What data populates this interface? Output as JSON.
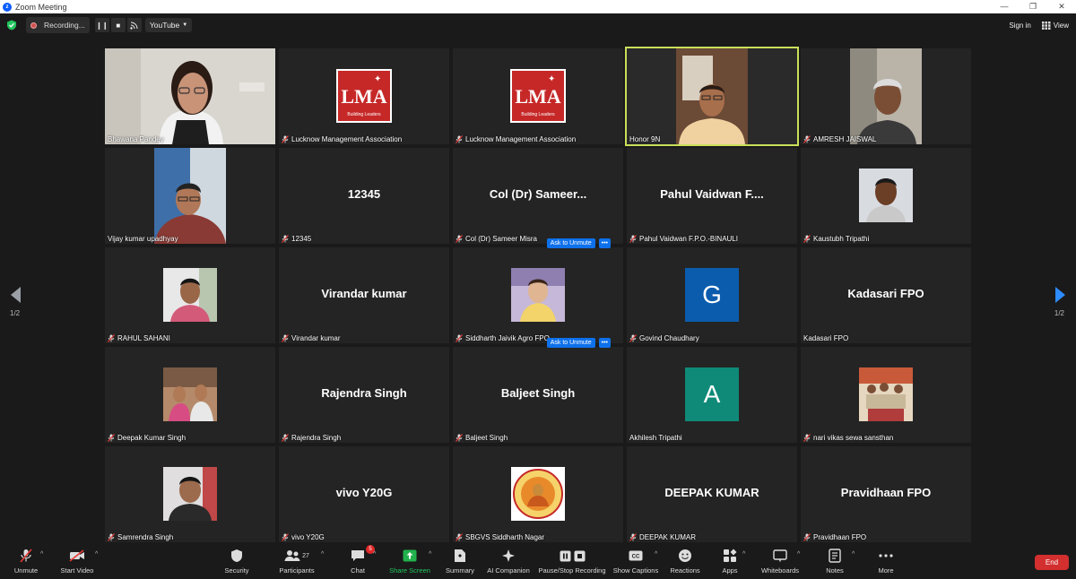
{
  "window": {
    "title": "Zoom Meeting"
  },
  "topbar": {
    "recording_label": "Recording...",
    "stream_label": "YouTube",
    "signin_label": "Sign in",
    "view_label": "View"
  },
  "pager": {
    "left": "1/2",
    "right": "1/2"
  },
  "tiles": [
    {
      "name": "Bhawana Pandey",
      "display": "",
      "kind": "video"
    },
    {
      "name": "Lucknow Management Association",
      "display": "",
      "kind": "logo"
    },
    {
      "name": "Lucknow Management Association",
      "display": "",
      "kind": "logo"
    },
    {
      "name": "Honor 9N",
      "display": "",
      "kind": "video"
    },
    {
      "name": "AMRESH JAISWAL",
      "display": "",
      "kind": "video"
    },
    {
      "name": "Vijay kumar upadhyay",
      "display": "",
      "kind": "video"
    },
    {
      "name": "12345",
      "display": "12345",
      "kind": "text"
    },
    {
      "name": "Col (Dr) Sameer Misra",
      "display": "Col  (Dr)  Sameer...",
      "kind": "text"
    },
    {
      "name": "Pahul Vaidwan F.P.O.-BINAULI",
      "display": "Pahul  Vaidwan  F....",
      "kind": "text"
    },
    {
      "name": "Kaustubh Tripathi",
      "display": "",
      "kind": "photo"
    },
    {
      "name": "RAHUL SAHANI",
      "display": "",
      "kind": "photo"
    },
    {
      "name": "Virandar kumar",
      "display": "Virandar kumar",
      "kind": "text"
    },
    {
      "name": "Siddharth Jaivik Agro FPO",
      "display": "",
      "kind": "photo"
    },
    {
      "name": "Govind Chaudhary",
      "display": "G",
      "kind": "letter"
    },
    {
      "name": "Kadasari FPO",
      "display": "Kadasari FPO",
      "kind": "text"
    },
    {
      "name": "Deepak Kumar Singh",
      "display": "",
      "kind": "photo"
    },
    {
      "name": "Rajendra Singh",
      "display": "Rajendra Singh",
      "kind": "text"
    },
    {
      "name": "Baljeet Singh",
      "display": "Baljeet Singh",
      "kind": "text"
    },
    {
      "name": "Akhilesh Tripathi",
      "display": "A",
      "kind": "letter"
    },
    {
      "name": "nari vikas sewa sansthan",
      "display": "",
      "kind": "photo"
    },
    {
      "name": "Samrendra Singh",
      "display": "",
      "kind": "photo"
    },
    {
      "name": "vivo Y20G",
      "display": "vivo Y20G",
      "kind": "text"
    },
    {
      "name": "SBGVS Siddharth Nagar",
      "display": "",
      "kind": "photo"
    },
    {
      "name": "DEEPAK KUMAR",
      "display": "DEEPAK KUMAR",
      "kind": "text"
    },
    {
      "name": "Pravidhaan FPO",
      "display": "Pravidhaan FPO",
      "kind": "text"
    }
  ],
  "ask_unmute": {
    "label": "Ask to Unmute",
    "more": "•••"
  },
  "toolbar": {
    "unmute": "Unmute",
    "start_video": "Start Video",
    "security": "Security",
    "participants": "Participants",
    "participants_count": "27",
    "chat": "Chat",
    "chat_badge": "5",
    "share_screen": "Share Screen",
    "summary": "Summary",
    "ai_companion": "AI Companion",
    "pause_stop_recording": "Pause/Stop Recording",
    "show_captions": "Show Captions",
    "reactions": "Reactions",
    "apps": "Apps",
    "whiteboards": "Whiteboards",
    "notes": "Notes",
    "more": "More",
    "end": "End"
  },
  "colors": {
    "active_speaker": "#c8e05a",
    "letter_G": "#0b5cad",
    "letter_A": "#0f8a78",
    "end_button": "#d32f2f",
    "share_green": "#22b14c"
  }
}
